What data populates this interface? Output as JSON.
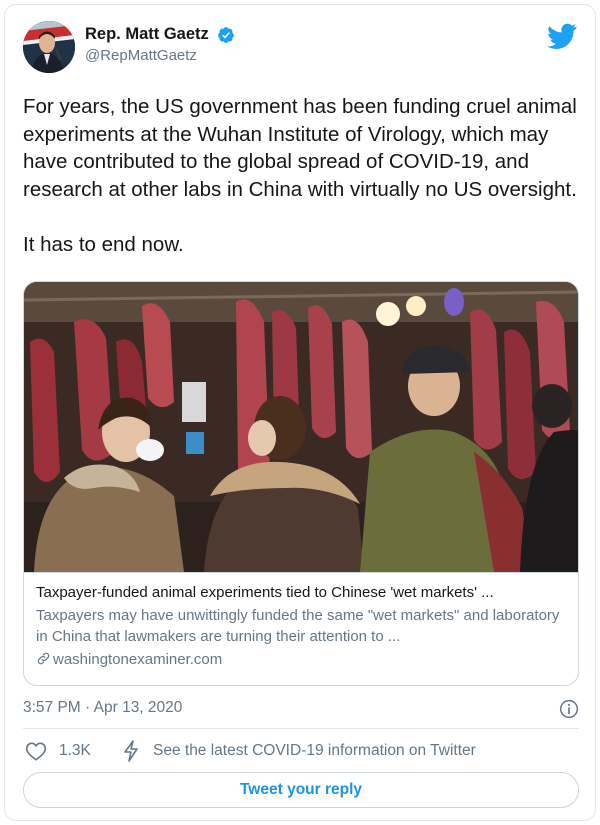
{
  "tweet": {
    "author_name": "Rep. Matt Gaetz",
    "author_handle": "@RepMattGaetz",
    "text_paragraphs": [
      "For years, the US government has been funding cruel animal experiments at the Wuhan Institute of Virology, which may have contributed to the global spread of COVID-19, and research at other labs in China with virtually no US oversight.",
      "It has to end now."
    ],
    "timestamp": "3:57 PM · Apr 13, 2020"
  },
  "link_card": {
    "title": "Taxpayer-funded animal experiments tied to Chinese 'wet markets' ...",
    "description": "Taxpayers may have unwittingly funded the same \"wet markets\" and laboratory in China that lawmakers are turning their attention to ...",
    "domain": "washingtonexaminer.com"
  },
  "actions": {
    "like_count": "1.3K",
    "covid_info": "See the latest COVID-19 information on Twitter",
    "reply_button": "Tweet your reply"
  },
  "icons": {
    "verified": "verified-badge-icon",
    "brand": "twitter-bird-icon",
    "info": "info-icon",
    "like": "heart-icon",
    "covid": "bolt-icon",
    "link": "link-icon"
  },
  "colors": {
    "twitter_blue": "#1da1f2",
    "reply_text": "#1b95e0",
    "secondary_text": "#657786",
    "border": "#ccd6dd"
  }
}
